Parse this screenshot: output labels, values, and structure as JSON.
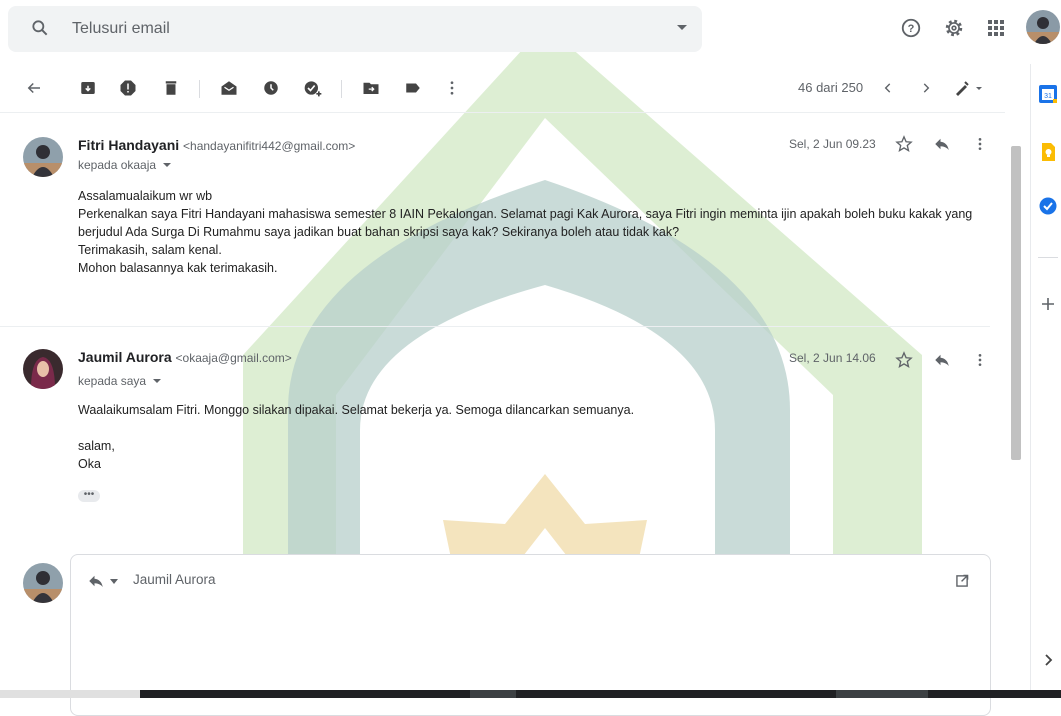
{
  "search": {
    "placeholder": "Telusuri email",
    "icons": [
      "search-icon",
      "dropdown-caret-icon"
    ]
  },
  "header_icons": [
    "help-icon",
    "settings-icon",
    "apps-icon",
    "account-avatar"
  ],
  "toolbar": {
    "icons": [
      "back-arrow-icon",
      "archive-icon",
      "report-spam-icon",
      "delete-icon",
      "mark-unread-icon",
      "snooze-icon",
      "add-task-icon",
      "move-to-icon",
      "label-icon",
      "more-vert-icon"
    ],
    "pagination": "46 dari 250",
    "nav_icons": [
      "chevron-left-icon",
      "chevron-right-icon",
      "input-tools-icon"
    ]
  },
  "messages": [
    {
      "sender_name": "Fitri Handayani",
      "sender_email": "<handayanifitri442@gmail.com>",
      "to_line": "kepada okaaja",
      "date": "Sel, 2 Jun 09.23",
      "body": [
        "Assalamualaikum wr wb",
        "Perkenalkan saya Fitri Handayani mahasiswa semester 8 IAIN Pekalongan. Selamat pagi Kak Aurora, saya Fitri ingin meminta ijin apakah boleh buku kakak yang",
        "berjudul Ada Surga Di Rumahmu saya jadikan buat bahan skripsi saya kak? Sekiranya boleh atau tidak kak?",
        "Terimakasih, salam kenal.",
        "Mohon balasannya kak terimakasih."
      ]
    },
    {
      "sender_name": "Jaumil Aurora",
      "sender_email": "<okaaja@gmail.com>",
      "to_line": "kepada saya",
      "date": "Sel, 2 Jun 14.06",
      "body": [
        "Waalaikumsalam Fitri. Monggo silakan dipakai. Selamat bekerja ya. Semoga dilancarkan semuanya.",
        "",
        "salam,",
        "Oka"
      ],
      "trimmed_content": "•••"
    }
  ],
  "reply": {
    "recipient": "Jaumil Aurora",
    "icons": [
      "reply-icon",
      "dropdown-caret-icon",
      "pop-out-icon"
    ]
  },
  "side_panel": {
    "icons": [
      "calendar-icon",
      "keep-icon",
      "tasks-icon",
      "add-addon-icon",
      "expand-panel-icon"
    ],
    "calendar_day": "31"
  },
  "colors": {
    "watermark_green": "#d2e8c4",
    "watermark_teal": "#b7cfcb",
    "watermark_gold": "#f2dfb3",
    "accent_blue": "#1a73e8"
  }
}
